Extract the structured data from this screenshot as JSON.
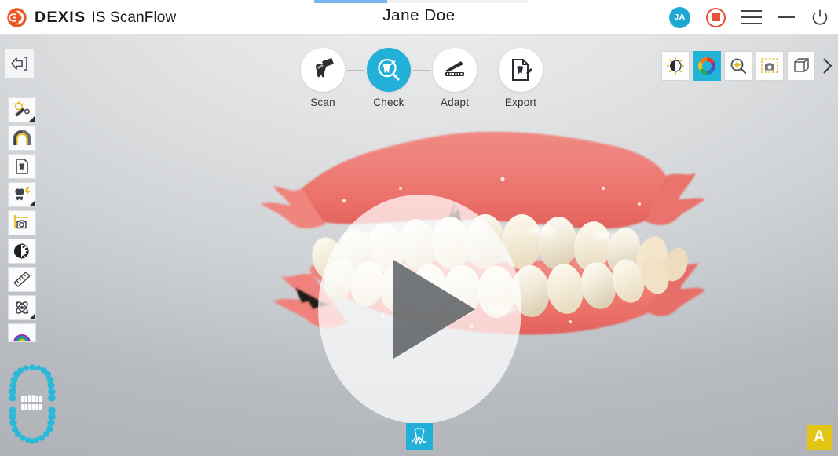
{
  "app": {
    "brand_primary": "DEXIS",
    "brand_product": "IS ScanFlow",
    "patient_name": "Jane  Doe",
    "accent_color": "#22b0d8",
    "record_color": "#e8503a",
    "badge_color": "#e3c515",
    "progress_color": "#7db5ee"
  },
  "header": {
    "avatar_initials": "JA",
    "record_label": "record-stop",
    "menu_label": "menu",
    "minimize_label": "minimize",
    "power_label": "power"
  },
  "workflow": {
    "steps": [
      {
        "label": "Scan",
        "icon": "scan-tooth-icon",
        "active": false
      },
      {
        "label": "Check",
        "icon": "check-magnifier-icon",
        "active": true
      },
      {
        "label": "Adapt",
        "icon": "adapt-tray-icon",
        "active": false
      },
      {
        "label": "Export",
        "icon": "export-file-icon",
        "active": false
      }
    ]
  },
  "right_toolbar": {
    "items": [
      {
        "name": "brightness-icon",
        "active": false
      },
      {
        "name": "color-wheel-icon",
        "active": true
      },
      {
        "name": "zoom-search-icon",
        "active": false
      },
      {
        "name": "screenshot-icon",
        "active": false
      },
      {
        "name": "cube-3d-icon",
        "active": false
      }
    ],
    "expand_label": "expand-toolbar-chevron"
  },
  "left_toolbar": {
    "back_label": "back-arrow-icon",
    "items": [
      {
        "name": "light-tool-icon",
        "has_corner": true
      },
      {
        "name": "arch-tool-icon",
        "has_corner": false
      },
      {
        "name": "document-tooth-icon",
        "has_corner": false
      },
      {
        "name": "tooth-shade-icon",
        "has_corner": true
      },
      {
        "name": "camera-crop-icon",
        "has_corner": false
      },
      {
        "name": "contrast-icon",
        "has_corner": false
      },
      {
        "name": "ruler-icon",
        "has_corner": false
      },
      {
        "name": "orbit-icon",
        "has_corner": true
      },
      {
        "name": "rainbow-arch-icon",
        "has_corner": false
      }
    ]
  },
  "viewport": {
    "play_overlay_label": "play-video-button",
    "model_label": "intraoral-3d-scan"
  },
  "bottom": {
    "center_button_label": "tooth-occlusion-button",
    "corner_badge_text": "A"
  }
}
